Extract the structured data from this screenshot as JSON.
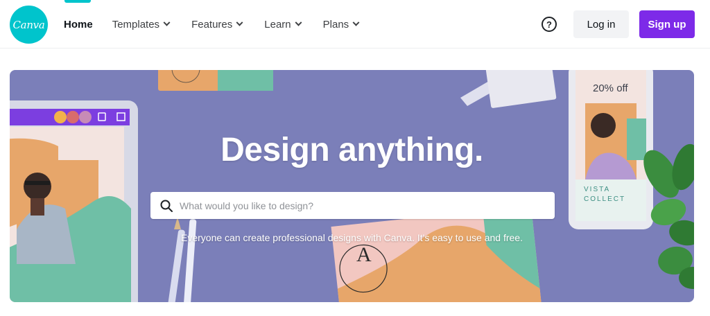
{
  "nav": {
    "logo_text": "Canva",
    "links": [
      {
        "label": "Home",
        "active": true,
        "has_dropdown": false
      },
      {
        "label": "Templates",
        "active": false,
        "has_dropdown": true
      },
      {
        "label": "Features",
        "active": false,
        "has_dropdown": true
      },
      {
        "label": "Learn",
        "active": false,
        "has_dropdown": true
      },
      {
        "label": "Plans",
        "active": false,
        "has_dropdown": true
      }
    ],
    "help_icon": "question-circle-icon",
    "help_glyph": "?",
    "login_label": "Log in",
    "signup_label": "Sign up"
  },
  "hero": {
    "title": "Design anything.",
    "search": {
      "placeholder": "What would you like to design?",
      "value": "",
      "icon": "search-icon"
    },
    "subtitle": "Everyone can create professional designs with Canva. It's easy to use and free.",
    "decor": {
      "promo_text": "20% off",
      "tagline_line1": "VISTA",
      "tagline_line2": "COLLECT",
      "monogram": "A"
    }
  },
  "colors": {
    "brand_teal": "#00c4cc",
    "brand_purple": "#7d2ae8",
    "hero_background": "#7b7fb9",
    "accent_green": "#6fbfa6",
    "accent_orange": "#e7a66a",
    "accent_pink": "#f2c7c1"
  }
}
